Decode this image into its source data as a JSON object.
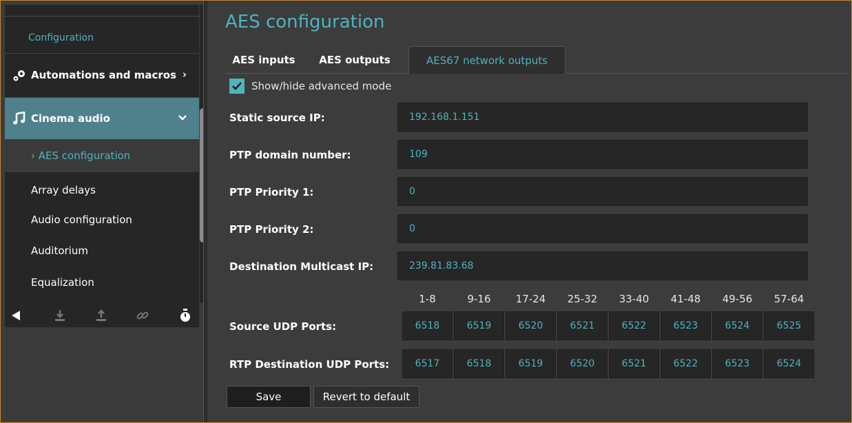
{
  "sidebar": {
    "section_label": "Configuration",
    "groups": [
      {
        "label": "Automations and macros",
        "icon": "gears-icon",
        "chevron": "›"
      },
      {
        "label": "Cinema audio",
        "icon": "music-note-icon",
        "chevron": "⌄"
      }
    ],
    "items": [
      {
        "label": "› AES configuration",
        "active": true
      },
      {
        "label": "Array delays"
      },
      {
        "label": "Audio configuration"
      },
      {
        "label": "Auditorium"
      },
      {
        "label": "Equalization"
      }
    ],
    "toolbar_icons": [
      "collapse-left-icon",
      "download-icon",
      "upload-icon",
      "link-icon",
      "timer-icon"
    ]
  },
  "main": {
    "title": "AES configuration",
    "tabs": [
      {
        "label": "AES inputs"
      },
      {
        "label": "AES outputs"
      },
      {
        "label": "AES67 network outputs",
        "active": true
      }
    ],
    "advanced_mode": {
      "label": "Show/hide advanced mode",
      "checked": true
    },
    "fields": [
      {
        "label": "Static source IP:",
        "value": "192.168.1.151"
      },
      {
        "label": "PTP domain number:",
        "value": "109"
      },
      {
        "label": "PTP Priority 1:",
        "value": "0"
      },
      {
        "label": "PTP Priority 2:",
        "value": "0"
      },
      {
        "label": "Destination Multicast IP:",
        "value": "239.81.83.68"
      }
    ],
    "port_columns": [
      "1-8",
      "9-16",
      "17-24",
      "25-32",
      "33-40",
      "41-48",
      "49-56",
      "57-64"
    ],
    "source_udp_label": "Source UDP Ports:",
    "source_udp_ports": [
      "6518",
      "6519",
      "6520",
      "6521",
      "6522",
      "6523",
      "6524",
      "6525"
    ],
    "rtp_udp_label": "RTP Destination UDP Ports:",
    "rtp_udp_ports": [
      "6517",
      "6518",
      "6519",
      "6520",
      "6521",
      "6522",
      "6523",
      "6524"
    ],
    "save_label": "Save",
    "revert_label": "Revert to default"
  },
  "colors": {
    "accent": "#4fb3bf",
    "active_group": "#4f818c",
    "frame": "#c8892a"
  }
}
